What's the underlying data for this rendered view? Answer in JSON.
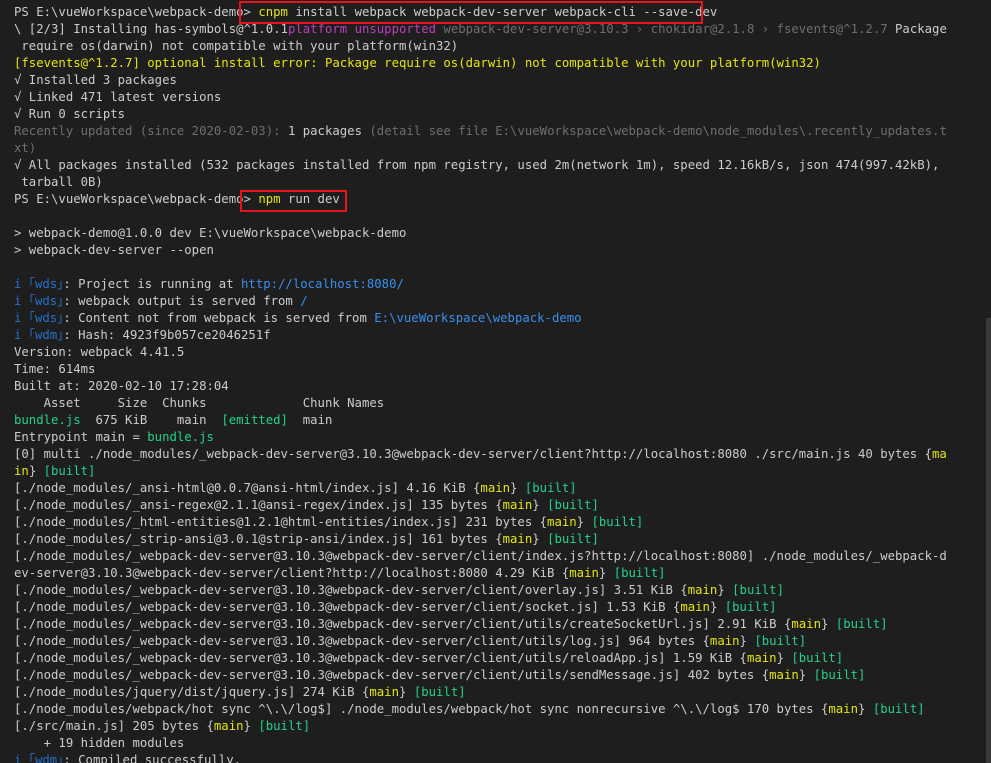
{
  "terminal": {
    "lines": [
      [
        {
          "t": "PS E:\\vueWorkspace\\webpack-demo> ",
          "c": "#cccccc"
        },
        {
          "t": "cnpm",
          "c": "#e5e510"
        },
        {
          "t": " install webpack webpack-dev-server webpack-cli --save-dev",
          "c": "#cccccc"
        }
      ],
      [
        {
          "t": "\\ [2/3] Installing has-symbols@^1.0.1",
          "c": "#cccccc"
        },
        {
          "t": "platform unsupported",
          "c": "#bc3fbc"
        },
        {
          "t": " webpack-dev-server@3.10.3 › chokidar@2.1.8 › fsevents@^1.2.7",
          "c": "#6e6e6e"
        },
        {
          "t": " Package",
          "c": "#cccccc"
        }
      ],
      [
        {
          "t": " require os(darwin) not compatible with your platform(win32)",
          "c": "#cccccc"
        }
      ],
      [
        {
          "t": "[fsevents@^1.2.7] optional install error: Package require os(darwin) not compatible with your platform(win32)",
          "c": "#e5e510"
        }
      ],
      [
        {
          "t": "√ Installed 3 packages",
          "c": "#cccccc"
        }
      ],
      [
        {
          "t": "√ Linked 471 latest versions",
          "c": "#cccccc"
        }
      ],
      [
        {
          "t": "√ Run 0 scripts",
          "c": "#cccccc"
        }
      ],
      [
        {
          "t": "Recently updated (since 2020-02-03): ",
          "c": "#6e6e6e"
        },
        {
          "t": "1 packages",
          "c": "#cccccc"
        },
        {
          "t": " (detail see file E:\\vueWorkspace\\webpack-demo\\node_modules\\.recently_updates.t",
          "c": "#6e6e6e"
        }
      ],
      [
        {
          "t": "xt)",
          "c": "#6e6e6e"
        }
      ],
      [
        {
          "t": "√ All packages installed (532 packages installed from npm registry, used 2m(network 1m), speed 12.16kB/s, json 474(997.42kB),",
          "c": "#cccccc"
        }
      ],
      [
        {
          "t": " tarball 0B)",
          "c": "#cccccc"
        }
      ],
      [
        {
          "t": "PS E:\\vueWorkspace\\webpack-demo> ",
          "c": "#cccccc"
        },
        {
          "t": "npm",
          "c": "#e5e510"
        },
        {
          "t": " run dev",
          "c": "#cccccc"
        }
      ],
      [],
      [
        {
          "t": "> webpack-demo@1.0.0 dev E:\\vueWorkspace\\webpack-demo",
          "c": "#cccccc"
        }
      ],
      [
        {
          "t": "> webpack-dev-server --open",
          "c": "#cccccc"
        }
      ],
      [],
      [
        {
          "t": "i ｢wds｣",
          "c": "#2472c8"
        },
        {
          "t": ": Project is running at ",
          "c": "#cccccc"
        },
        {
          "t": "http://localhost:8080/",
          "c": "#3b8eea"
        }
      ],
      [
        {
          "t": "i ｢wds｣",
          "c": "#2472c8"
        },
        {
          "t": ": webpack output is served from ",
          "c": "#cccccc"
        },
        {
          "t": "/",
          "c": "#3b8eea"
        }
      ],
      [
        {
          "t": "i ｢wds｣",
          "c": "#2472c8"
        },
        {
          "t": ": Content not from webpack is served from ",
          "c": "#cccccc"
        },
        {
          "t": "E:\\vueWorkspace\\webpack-demo",
          "c": "#3b8eea"
        }
      ],
      [
        {
          "t": "i ｢wdm｣",
          "c": "#2472c8"
        },
        {
          "t": ": Hash: 4923f9b057ce2046251f",
          "c": "#cccccc"
        }
      ],
      [
        {
          "t": "Version: webpack 4.41.5",
          "c": "#cccccc"
        }
      ],
      [
        {
          "t": "Time: 614ms",
          "c": "#cccccc"
        }
      ],
      [
        {
          "t": "Built at: 2020-02-10 17:28:04",
          "c": "#cccccc"
        }
      ],
      [
        {
          "t": "    Asset     Size  Chunks             Chunk Names",
          "c": "#cccccc"
        }
      ],
      [
        {
          "t": "bundle.js",
          "c": "#23d18b"
        },
        {
          "t": "  675 KiB    ",
          "c": "#cccccc"
        },
        {
          "t": "main",
          "c": "#cccccc"
        },
        {
          "t": "  ",
          "c": "#cccccc"
        },
        {
          "t": "[emitted]",
          "c": "#23d18b"
        },
        {
          "t": "  main",
          "c": "#cccccc"
        }
      ],
      [
        {
          "t": "Entrypoint ",
          "c": "#cccccc"
        },
        {
          "t": "main",
          "c": "#cccccc"
        },
        {
          "t": " = ",
          "c": "#cccccc"
        },
        {
          "t": "bundle.js",
          "c": "#23d18b"
        }
      ],
      [
        {
          "t": "[0] multi ./node_modules/_webpack-dev-server@3.10.3@webpack-dev-server/client?http://localhost:8080 ./src/main.js 40 bytes {",
          "c": "#cccccc"
        },
        {
          "t": "ma",
          "c": "#e5e510"
        }
      ],
      [
        {
          "t": "in",
          "c": "#e5e510"
        },
        {
          "t": "} ",
          "c": "#cccccc"
        },
        {
          "t": "[built]",
          "c": "#23d18b"
        }
      ],
      [
        {
          "t": "[./node_modules/_ansi-html@0.0.7@ansi-html/index.js] 4.16 KiB {",
          "c": "#cccccc"
        },
        {
          "t": "main",
          "c": "#e5e510"
        },
        {
          "t": "} ",
          "c": "#cccccc"
        },
        {
          "t": "[built]",
          "c": "#23d18b"
        }
      ],
      [
        {
          "t": "[./node_modules/_ansi-regex@2.1.1@ansi-regex/index.js] 135 bytes {",
          "c": "#cccccc"
        },
        {
          "t": "main",
          "c": "#e5e510"
        },
        {
          "t": "} ",
          "c": "#cccccc"
        },
        {
          "t": "[built]",
          "c": "#23d18b"
        }
      ],
      [
        {
          "t": "[./node_modules/_html-entities@1.2.1@html-entities/index.js] 231 bytes {",
          "c": "#cccccc"
        },
        {
          "t": "main",
          "c": "#e5e510"
        },
        {
          "t": "} ",
          "c": "#cccccc"
        },
        {
          "t": "[built]",
          "c": "#23d18b"
        }
      ],
      [
        {
          "t": "[./node_modules/_strip-ansi@3.0.1@strip-ansi/index.js] 161 bytes {",
          "c": "#cccccc"
        },
        {
          "t": "main",
          "c": "#e5e510"
        },
        {
          "t": "} ",
          "c": "#cccccc"
        },
        {
          "t": "[built]",
          "c": "#23d18b"
        }
      ],
      [
        {
          "t": "[./node_modules/_webpack-dev-server@3.10.3@webpack-dev-server/client/index.js?http://localhost:8080] ./node_modules/_webpack-d",
          "c": "#cccccc"
        }
      ],
      [
        {
          "t": "ev-server@3.10.3@webpack-dev-server/client?http://localhost:8080 4.29 KiB {",
          "c": "#cccccc"
        },
        {
          "t": "main",
          "c": "#e5e510"
        },
        {
          "t": "} ",
          "c": "#cccccc"
        },
        {
          "t": "[built]",
          "c": "#23d18b"
        }
      ],
      [
        {
          "t": "[./node_modules/_webpack-dev-server@3.10.3@webpack-dev-server/client/overlay.js] 3.51 KiB {",
          "c": "#cccccc"
        },
        {
          "t": "main",
          "c": "#e5e510"
        },
        {
          "t": "} ",
          "c": "#cccccc"
        },
        {
          "t": "[built]",
          "c": "#23d18b"
        }
      ],
      [
        {
          "t": "[./node_modules/_webpack-dev-server@3.10.3@webpack-dev-server/client/socket.js] 1.53 KiB {",
          "c": "#cccccc"
        },
        {
          "t": "main",
          "c": "#e5e510"
        },
        {
          "t": "} ",
          "c": "#cccccc"
        },
        {
          "t": "[built]",
          "c": "#23d18b"
        }
      ],
      [
        {
          "t": "[./node_modules/_webpack-dev-server@3.10.3@webpack-dev-server/client/utils/createSocketUrl.js] 2.91 KiB {",
          "c": "#cccccc"
        },
        {
          "t": "main",
          "c": "#e5e510"
        },
        {
          "t": "} ",
          "c": "#cccccc"
        },
        {
          "t": "[built]",
          "c": "#23d18b"
        }
      ],
      [
        {
          "t": "[./node_modules/_webpack-dev-server@3.10.3@webpack-dev-server/client/utils/log.js] 964 bytes {",
          "c": "#cccccc"
        },
        {
          "t": "main",
          "c": "#e5e510"
        },
        {
          "t": "} ",
          "c": "#cccccc"
        },
        {
          "t": "[built]",
          "c": "#23d18b"
        }
      ],
      [
        {
          "t": "[./node_modules/_webpack-dev-server@3.10.3@webpack-dev-server/client/utils/reloadApp.js] 1.59 KiB {",
          "c": "#cccccc"
        },
        {
          "t": "main",
          "c": "#e5e510"
        },
        {
          "t": "} ",
          "c": "#cccccc"
        },
        {
          "t": "[built]",
          "c": "#23d18b"
        }
      ],
      [
        {
          "t": "[./node_modules/_webpack-dev-server@3.10.3@webpack-dev-server/client/utils/sendMessage.js] 402 bytes {",
          "c": "#cccccc"
        },
        {
          "t": "main",
          "c": "#e5e510"
        },
        {
          "t": "} ",
          "c": "#cccccc"
        },
        {
          "t": "[built]",
          "c": "#23d18b"
        }
      ],
      [
        {
          "t": "[./node_modules/jquery/dist/jquery.js] 274 KiB {",
          "c": "#cccccc"
        },
        {
          "t": "main",
          "c": "#e5e510"
        },
        {
          "t": "} ",
          "c": "#cccccc"
        },
        {
          "t": "[built]",
          "c": "#23d18b"
        }
      ],
      [
        {
          "t": "[./node_modules/webpack/hot sync ^\\.\\/log$] ./node_modules/webpack/hot sync nonrecursive ^\\.\\/log$ 170 bytes {",
          "c": "#cccccc"
        },
        {
          "t": "main",
          "c": "#e5e510"
        },
        {
          "t": "} ",
          "c": "#cccccc"
        },
        {
          "t": "[built]",
          "c": "#23d18b"
        }
      ],
      [
        {
          "t": "[./src/main.js] 205 bytes {",
          "c": "#cccccc"
        },
        {
          "t": "main",
          "c": "#e5e510"
        },
        {
          "t": "} ",
          "c": "#cccccc"
        },
        {
          "t": "[built]",
          "c": "#23d18b"
        }
      ],
      [
        {
          "t": "    + 19 hidden modules",
          "c": "#cccccc"
        }
      ],
      [
        {
          "t": "i ｢wdm｣",
          "c": "#2472c8"
        },
        {
          "t": ": Compiled successfully.",
          "c": "#cccccc"
        }
      ]
    ]
  },
  "highlights": [
    {
      "label": "cnpm-install-command"
    },
    {
      "label": "npm-run-dev-command"
    }
  ],
  "colors": {
    "background": "#1e1e1e",
    "foreground": "#cccccc",
    "highlight_border": "#e8141d"
  }
}
